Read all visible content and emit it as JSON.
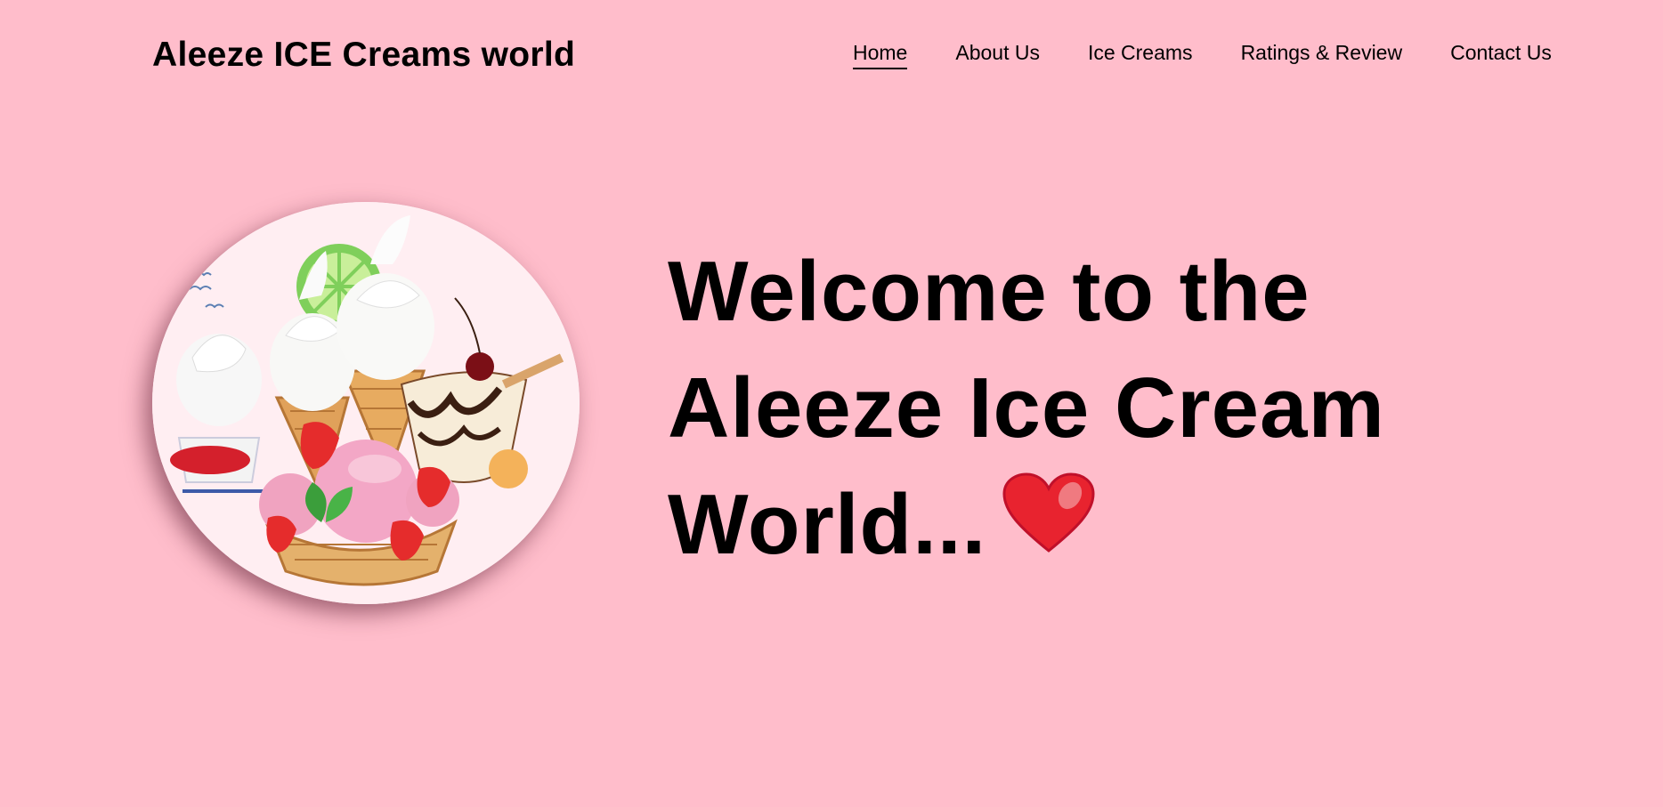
{
  "header": {
    "brand": "Aleeze ICE Creams world",
    "nav": [
      {
        "label": "Home",
        "active": true
      },
      {
        "label": "About Us",
        "active": false
      },
      {
        "label": "Ice Creams",
        "active": false
      },
      {
        "label": "Ratings & Review",
        "active": false
      },
      {
        "label": "Contact Us",
        "active": false
      }
    ]
  },
  "hero": {
    "title_line1": "Welcome to the",
    "title_line2": "Aleeze Ice Cream",
    "title_line3": "World...",
    "emoji_icon": "red-heart-icon",
    "image_description_icon": "ice-cream-collage-image"
  },
  "colors": {
    "background": "#ffbdcb",
    "text": "#000000",
    "heart": "#e8232f"
  }
}
